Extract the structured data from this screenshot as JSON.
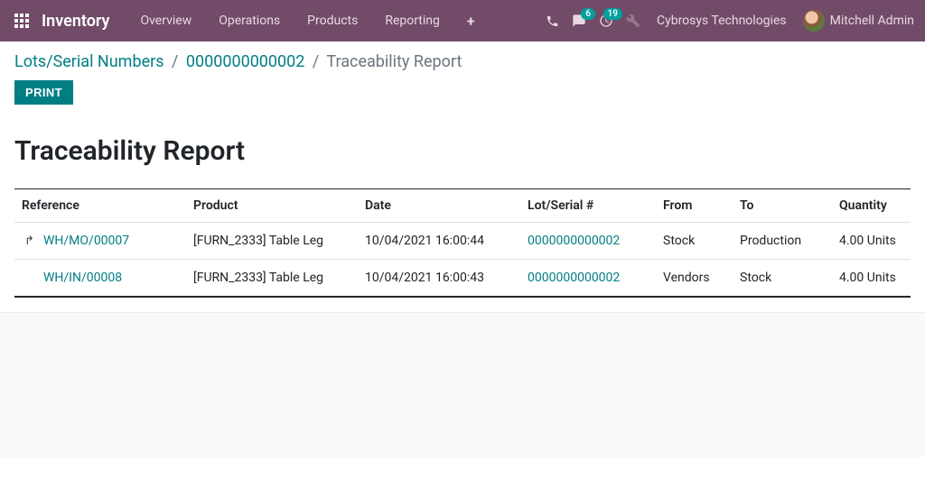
{
  "navbar": {
    "brand": "Inventory",
    "links": [
      "Overview",
      "Operations",
      "Products",
      "Reporting"
    ],
    "chat_badge": "6",
    "activity_badge": "19",
    "company": "Cybrosys Technologies",
    "user": "Mitchell Admin"
  },
  "breadcrumb": {
    "level1": "Lots/Serial Numbers",
    "level2": "0000000000002",
    "level3": "Traceability Report"
  },
  "buttons": {
    "print": "PRINT"
  },
  "report": {
    "title": "Traceability Report",
    "columns": [
      "Reference",
      "Product",
      "Date",
      "Lot/Serial #",
      "From",
      "To",
      "Quantity"
    ],
    "rows": [
      {
        "unfoldable": true,
        "reference": "WH/MO/00007",
        "product": "[FURN_2333] Table Leg",
        "date": "10/04/2021 16:00:44",
        "lot": "0000000000002",
        "from": "Stock",
        "to": "Production",
        "qty": "4.00 Units"
      },
      {
        "unfoldable": false,
        "reference": "WH/IN/00008",
        "product": "[FURN_2333] Table Leg",
        "date": "10/04/2021 16:00:43",
        "lot": "0000000000002",
        "from": "Vendors",
        "to": "Stock",
        "qty": "4.00 Units"
      }
    ]
  }
}
